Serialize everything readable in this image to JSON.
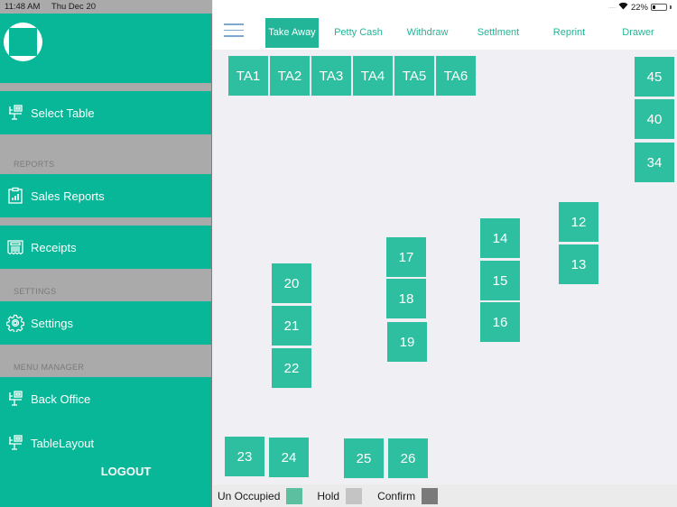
{
  "status_bar": {
    "time": "11:48 AM",
    "date": "Thu Dec 20",
    "battery_text": "22%",
    "battery_level": 0.22
  },
  "sidebar": {
    "items": [
      {
        "id": "select-table",
        "label": "Select Table",
        "icon": "table-desk-icon"
      },
      {
        "id": "sales-reports",
        "label": "Sales Reports",
        "icon": "clipboard-chart-icon"
      },
      {
        "id": "receipts",
        "label": "Receipts",
        "icon": "receipt-icon"
      },
      {
        "id": "settings",
        "label": "Settings",
        "icon": "gear-icon"
      },
      {
        "id": "back-office",
        "label": "Back Office",
        "icon": "table-desk-icon"
      },
      {
        "id": "table-layout",
        "label": "TableLayout",
        "icon": "table-desk-icon"
      }
    ],
    "sections": {
      "reports": "REPORTS",
      "settings": "SETTINGS",
      "menu_manager": "MENU MANAGER"
    },
    "logout": "LOGOUT"
  },
  "nav": {
    "tabs": [
      {
        "label": "Take Away",
        "active": true
      },
      {
        "label": "Petty Cash",
        "active": false
      },
      {
        "label": "Withdraw",
        "active": false
      },
      {
        "label": "Settlment",
        "active": false
      },
      {
        "label": "Reprint",
        "active": false
      },
      {
        "label": "Drawer",
        "active": false
      }
    ]
  },
  "tables": {
    "takeaway": [
      "TA1",
      "TA2",
      "TA3",
      "TA4",
      "TA5",
      "TA6"
    ],
    "dine_in": [
      "45",
      "40",
      "34",
      "12",
      "13",
      "14",
      "15",
      "16",
      "17",
      "18",
      "19",
      "20",
      "21",
      "22",
      "23",
      "24",
      "25",
      "26"
    ]
  },
  "legend": [
    {
      "label": "Un Occupied",
      "color": "#5cbfa0"
    },
    {
      "label": "Hold",
      "color": "#c4c4c4"
    },
    {
      "label": "Confirm",
      "color": "#7a7a7a"
    }
  ],
  "colors": {
    "accent": "#08b797",
    "table": "#2dbf9f",
    "sidebar_gray": "#aaaaaa"
  }
}
